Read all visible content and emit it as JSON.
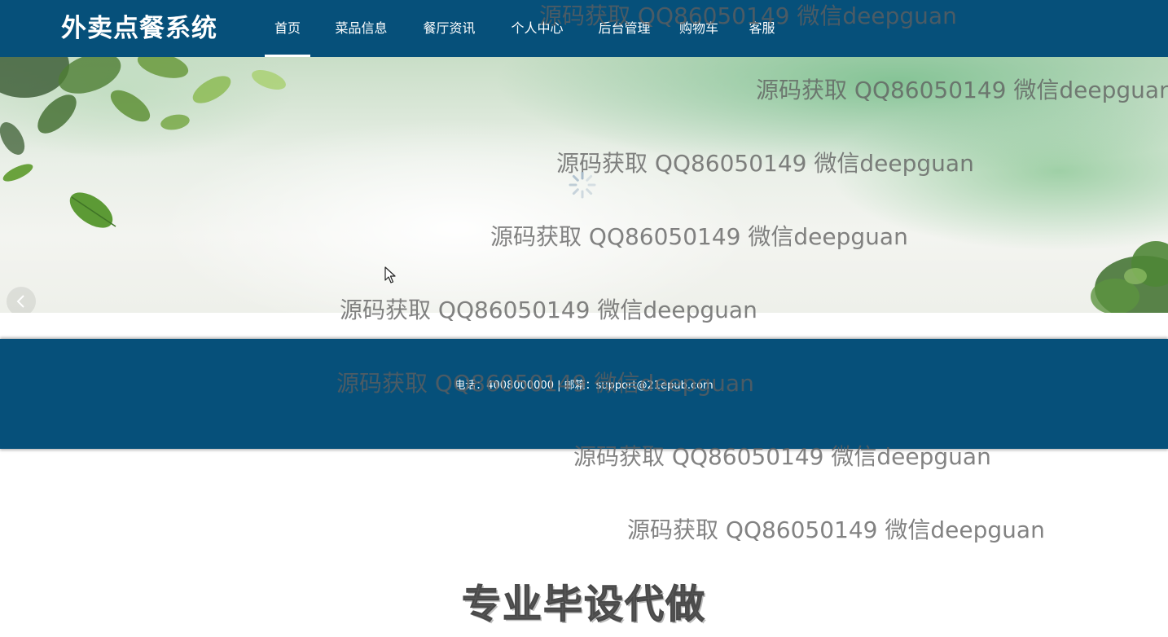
{
  "header": {
    "logo_text": "外卖点餐系统",
    "nav": [
      {
        "label": "首页",
        "active": true
      },
      {
        "label": "菜品信息",
        "active": false
      },
      {
        "label": "餐厅资讯",
        "active": false
      },
      {
        "label": "个人中心",
        "active": false
      },
      {
        "label": "后台管理",
        "active": false
      },
      {
        "label": "购物车",
        "active": false
      },
      {
        "label": "客服",
        "active": false
      }
    ]
  },
  "banner": {
    "prev_icon": "chevron-left-icon",
    "loading_icon": "spinner-icon"
  },
  "footer": {
    "contact_text": "电话：4008000000 | 邮箱：support@21epub.com"
  },
  "watermark": {
    "text": "源码获取 QQ86050149 微信deepguan",
    "promo_text": "专业毕设代做"
  },
  "colors": {
    "header_bg": "#06507a",
    "footer_bg": "#06507a",
    "nav_text": "#ffffff"
  }
}
